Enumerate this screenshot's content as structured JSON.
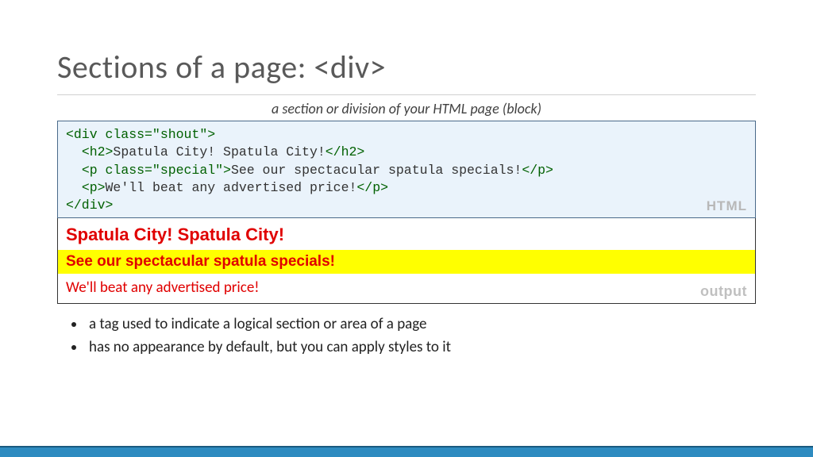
{
  "title": "Sections of a page: <div>",
  "subtitle": "a section or division of your HTML page (block)",
  "code": {
    "line1_open": "<div class=\"shout\">",
    "line2_open": "<h2>",
    "line2_text": "Spatula City!  Spatula City!",
    "line2_close": "</h2>",
    "line3_open": "<p class=\"special\">",
    "line3_text": "See our spectacular spatula specials!",
    "line3_close": "</p>",
    "line4_open": "<p>",
    "line4_text": "We'll beat any advertised price!",
    "line4_close": "</p>",
    "line5_close": "</div>",
    "label": "HTML"
  },
  "output": {
    "heading": "Spatula City! Spatula City!",
    "special": "See our spectacular spatula specials!",
    "para": "We'll beat any advertised price!",
    "label": "output"
  },
  "bullets": [
    "a tag used to indicate a logical section or area of a page",
    "has no appearance by default, but you can apply styles to it"
  ]
}
